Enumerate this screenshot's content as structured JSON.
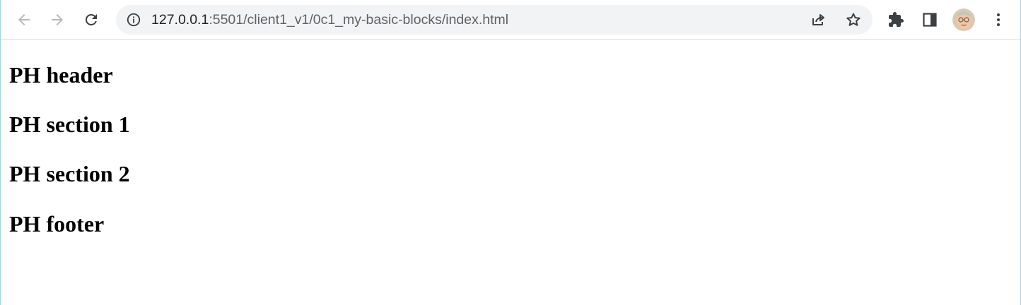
{
  "browser": {
    "url_host": "127.0.0.1",
    "url_rest": ":5501/client1_v1/0c1_my-basic-blocks/index.html",
    "icons": {
      "back": "arrow-left-icon",
      "forward": "arrow-right-icon",
      "reload": "reload-icon",
      "site_info": "info-icon",
      "share": "share-icon",
      "bookmark": "star-icon",
      "extensions": "puzzle-icon",
      "side_panel": "side-panel-icon",
      "profile": "avatar",
      "menu": "kebab-menu-icon"
    },
    "colors": {
      "toolbar_bg": "#ffffff",
      "omnibox_bg": "#f1f3f4",
      "icon": "#5f6368",
      "icon_disabled": "#b7b9bc"
    }
  },
  "page": {
    "headings": [
      "PH header",
      "PH section 1",
      "PH section 2",
      "PH footer"
    ]
  }
}
